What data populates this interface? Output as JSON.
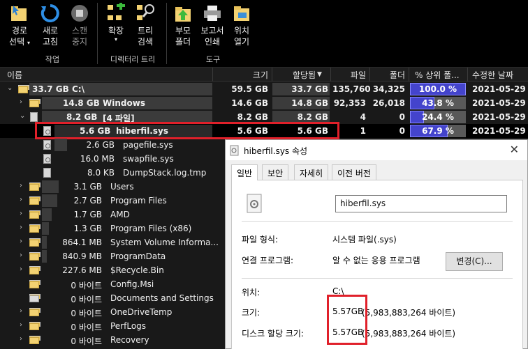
{
  "ribbon": {
    "buttons": [
      {
        "line1": "경로",
        "line2": "선택",
        "dropdown": true,
        "icon": "folder-select-icon"
      },
      {
        "line1": "새로",
        "line2": "고침",
        "dropdown": false,
        "icon": "refresh-icon"
      },
      {
        "line1": "스캔",
        "line2": "중지",
        "dropdown": false,
        "icon": "stop-icon"
      },
      {
        "line1": "확장",
        "line2": "",
        "dropdown": true,
        "icon": "expand-icon"
      },
      {
        "line1": "트리",
        "line2": "검색",
        "dropdown": false,
        "icon": "tree-search-icon"
      },
      {
        "line1": "부모",
        "line2": "폴더",
        "dropdown": false,
        "icon": "parent-folder-icon"
      },
      {
        "line1": "보고서",
        "line2": "인쇄",
        "dropdown": false,
        "icon": "print-icon"
      },
      {
        "line1": "위치",
        "line2": "열기",
        "dropdown": false,
        "icon": "open-location-icon"
      }
    ],
    "groups": [
      "작업",
      "디렉터리 트리",
      "도구"
    ]
  },
  "columns": {
    "name": "이름",
    "size": "크기",
    "allocated": "할당됨",
    "files": "파일",
    "folders": "폴더",
    "percent": "% 상위 폴...",
    "modified": "수정한 날짜"
  },
  "rows": [
    {
      "size_label": "33.7 GB",
      "name": "C:\\",
      "size": "59.5 GB",
      "allocated": "33.7 GB",
      "files": "135,760",
      "folders": "34,325",
      "percent": "100.0 %",
      "pct": 100,
      "date": "2021-05-29"
    },
    {
      "size_label": "14.8 GB",
      "name": "Windows",
      "size": "14.6 GB",
      "allocated": "14.8 GB",
      "files": "92,353",
      "folders": "26,018",
      "percent": "43.8 %",
      "pct": 43.8,
      "date": "2021-05-29"
    },
    {
      "size_label": "8.2 GB",
      "name": "[4 파일]",
      "size": "8.2 GB",
      "allocated": "8.2 GB",
      "files": "4",
      "folders": "0",
      "percent": "24.4 %",
      "pct": 24.4,
      "date": "2021-05-29"
    },
    {
      "size_label": "5.6 GB",
      "name": "hiberfil.sys",
      "size": "5.6 GB",
      "allocated": "5.6 GB",
      "files": "1",
      "folders": "0",
      "percent": "67.9 %",
      "pct": 67.9,
      "date": "2021-05-29"
    },
    {
      "size_label": "2.6 GB",
      "name": "pagefile.sys"
    },
    {
      "size_label": "16.0 MB",
      "name": "swapfile.sys"
    },
    {
      "size_label": "8.0 KB",
      "name": "DumpStack.log.tmp"
    },
    {
      "size_label": "3.1 GB",
      "name": "Users"
    },
    {
      "size_label": "2.7 GB",
      "name": "Program Files"
    },
    {
      "size_label": "1.7 GB",
      "name": "AMD"
    },
    {
      "size_label": "1.3 GB",
      "name": "Program Files (x86)"
    },
    {
      "size_label": "864.1 MB",
      "name": "System Volume Informa..."
    },
    {
      "size_label": "840.9 MB",
      "name": "ProgramData"
    },
    {
      "size_label": "227.6 MB",
      "name": "$Recycle.Bin"
    },
    {
      "size_label": "0 바이트",
      "name": "Config.Msi"
    },
    {
      "size_label": "0 바이트",
      "name": "Documents and Settings"
    },
    {
      "size_label": "0 바이트",
      "name": "OneDriveTemp"
    },
    {
      "size_label": "0 바이트",
      "name": "PerfLogs"
    },
    {
      "size_label": "0 바이트",
      "name": "Recovery"
    }
  ],
  "dialog": {
    "title": "hiberfil.sys 속성",
    "close": "✕",
    "tabs": [
      "일반",
      "보안",
      "자세히",
      "이전 버전"
    ],
    "filename": "hiberfil.sys",
    "type_label": "파일 형식:",
    "type_value": "시스템 파일(.sys)",
    "program_label": "연결 프로그램:",
    "program_value": "알 수 없는 응용 프로그램",
    "change_button": "변경(C)...",
    "location_label": "위치:",
    "location_value": "C:\\",
    "size_label": "크기:",
    "size_value_a": "5.57GB",
    "size_value_b": "(5,983,883,264 바이트)",
    "disk_label": "디스크 할당 크기:",
    "disk_value_a": "5.57GB",
    "disk_value_b": "(5,983,883,264 바이트)"
  },
  "colors": {
    "highlight": "#e0202a",
    "percent_bar": "#4444cc"
  }
}
